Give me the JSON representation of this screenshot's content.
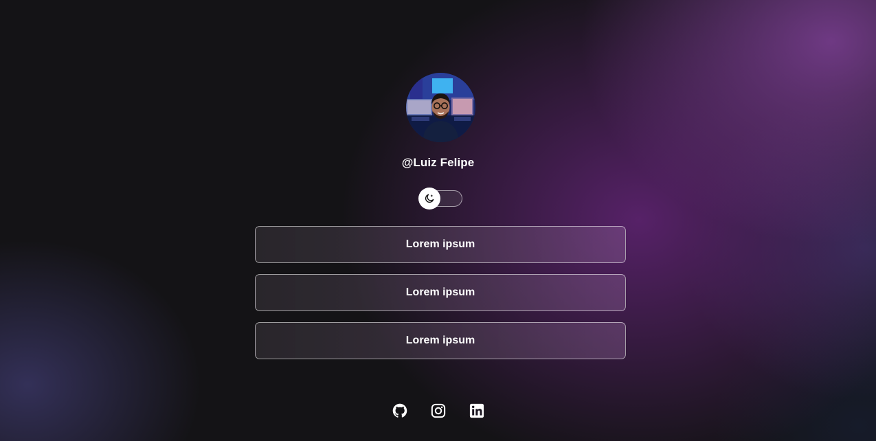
{
  "profile": {
    "username": "@Luiz Felipe",
    "avatar_icon": "profile-photo"
  },
  "theme_toggle": {
    "icon": "moon-icon",
    "state": "dark"
  },
  "links": [
    {
      "label": "Lorem ipsum"
    },
    {
      "label": "Lorem ipsum"
    },
    {
      "label": "Lorem ipsum"
    }
  ],
  "socials": [
    {
      "icon": "github-icon"
    },
    {
      "icon": "instagram-icon"
    },
    {
      "icon": "linkedin-icon"
    }
  ]
}
